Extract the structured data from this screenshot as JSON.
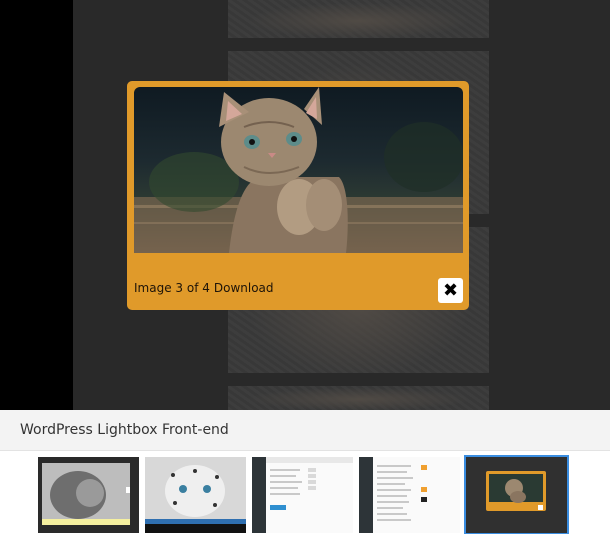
{
  "lightbox": {
    "counter": "Image 3 of 4",
    "download_label": "Download",
    "close_glyph": "✖",
    "photo_icon": "kitten-photo",
    "frame_color": "#e09a2a"
  },
  "caption": {
    "text": "WordPress Lightbox Front-end"
  },
  "thumbnails": [
    {
      "subject": "lion-photo"
    },
    {
      "subject": "snow-leopard-photo"
    },
    {
      "subject": "admin-settings-screenshot"
    },
    {
      "subject": "admin-settings-screenshot"
    },
    {
      "subject": "lightbox-kitten-screenshot",
      "selected": true
    }
  ],
  "colors": {
    "selected_outline": "#3a8de0",
    "overlay": "#2b2b2b"
  }
}
